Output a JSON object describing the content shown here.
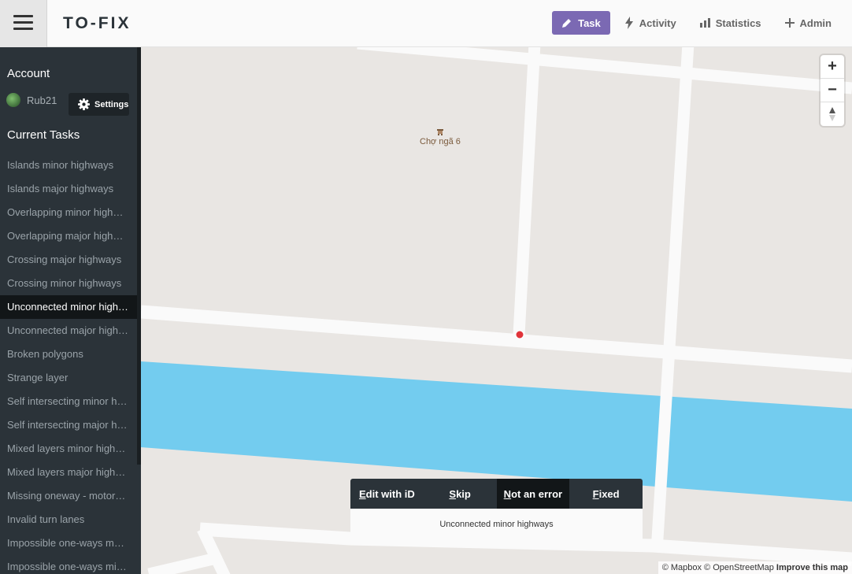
{
  "header": {
    "logo": "TO-FIX",
    "nav": [
      {
        "label": "Task",
        "icon": "pencil-icon",
        "active": true
      },
      {
        "label": "Activity",
        "icon": "bolt-icon",
        "active": false
      },
      {
        "label": "Statistics",
        "icon": "bar-chart-icon",
        "active": false
      },
      {
        "label": "Admin",
        "icon": "plus-icon",
        "active": false
      }
    ]
  },
  "sidebar": {
    "account_title": "Account",
    "username": "Rub21",
    "settings_label": "Settings",
    "tasks_title": "Current Tasks",
    "tasks": [
      "Islands minor highways",
      "Islands major highways",
      "Overlapping minor highways",
      "Overlapping major highways",
      "Crossing major highways",
      "Crossing minor highways",
      "Unconnected minor highways",
      "Unconnected major highways",
      "Broken polygons",
      "Strange layer",
      "Self intersecting minor highways",
      "Self intersecting major highways",
      "Mixed layers minor highways",
      "Mixed layers major highways",
      "Missing oneway - motorways",
      "Invalid turn lanes",
      "Impossible one-ways major",
      "Impossible one-ways minor"
    ],
    "active_task_index": 6
  },
  "map": {
    "poi_label": "Chợ ngã 6",
    "zoom_in": "+",
    "zoom_out": "−",
    "compass": "▲",
    "attribution": "© Mapbox © OpenStreetMap",
    "improve": "Improve this map",
    "colors": {
      "land": "#e9e6e3",
      "road": "#fafafa",
      "water": "#73ccef",
      "marker": "#e0343a"
    }
  },
  "task_panel": {
    "buttons": [
      {
        "key": "E",
        "rest": "dit with iD"
      },
      {
        "key": "S",
        "rest": "kip"
      },
      {
        "key": "N",
        "rest": "ot an error"
      },
      {
        "key": "F",
        "rest": "ixed"
      }
    ],
    "task_name": "Unconnected minor highways"
  }
}
